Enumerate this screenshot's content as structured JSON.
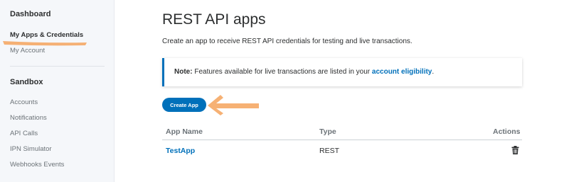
{
  "sidebar": {
    "dashboard_heading": "Dashboard",
    "dashboard_items": [
      {
        "label": "My Apps & Credentials",
        "active": true
      },
      {
        "label": "My Account",
        "active": false
      }
    ],
    "sandbox_heading": "Sandbox",
    "sandbox_items": [
      {
        "label": "Accounts"
      },
      {
        "label": "Notifications"
      },
      {
        "label": "API Calls"
      },
      {
        "label": "IPN Simulator"
      },
      {
        "label": "Webhooks Events"
      }
    ]
  },
  "main": {
    "title": "REST API apps",
    "description": "Create an app to receive REST API credentials for testing and live transactions.",
    "note": {
      "label": "Note:",
      "text": " Features available for live transactions are listed in your ",
      "link": "account eligibility",
      "suffix": "."
    },
    "create_button": "Create App",
    "table": {
      "headers": {
        "name": "App Name",
        "type": "Type",
        "actions": "Actions"
      },
      "rows": [
        {
          "name": "TestApp",
          "type": "REST",
          "action_icon": "trash-icon"
        }
      ]
    }
  },
  "colors": {
    "accent": "#0070ba",
    "highlight": "#f5a35c",
    "sidebar_bg": "#f5f7fa"
  }
}
